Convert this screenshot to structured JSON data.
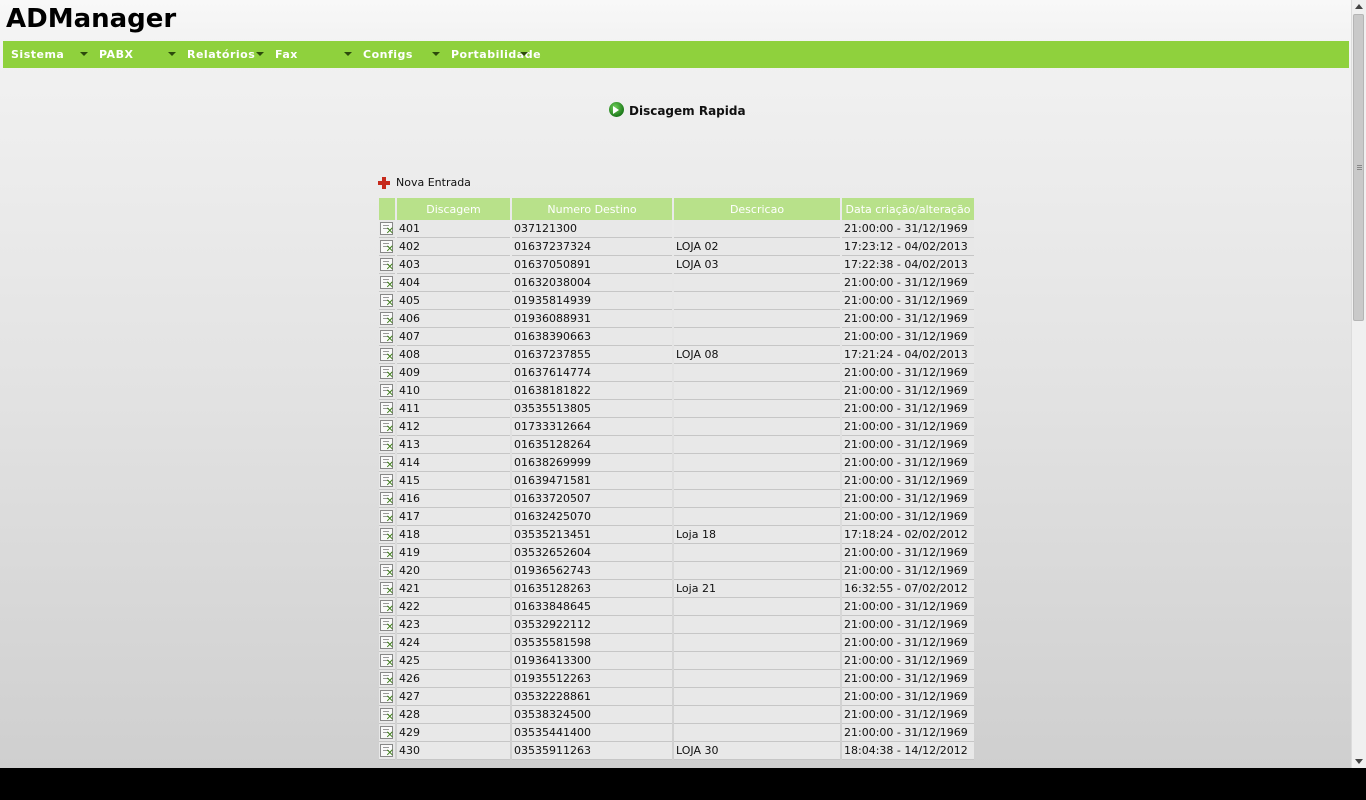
{
  "app": {
    "title": "ADManager"
  },
  "menu": [
    {
      "label": "Sistema"
    },
    {
      "label": "PABX"
    },
    {
      "label": "Relatórios"
    },
    {
      "label": "Fax"
    },
    {
      "label": "Configs"
    },
    {
      "label": "Portabilidade"
    }
  ],
  "page": {
    "heading": "Discagem Rapida",
    "new_entry_label": "Nova Entrada"
  },
  "table": {
    "columns": [
      "Discagem",
      "Numero Destino",
      "Descricao",
      "Data criação/alteração"
    ],
    "rows": [
      [
        "401",
        "037121300",
        "",
        "21:00:00 - 31/12/1969"
      ],
      [
        "402",
        "01637237324",
        "LOJA 02",
        "17:23:12 - 04/02/2013"
      ],
      [
        "403",
        "01637050891",
        "LOJA 03",
        "17:22:38 - 04/02/2013"
      ],
      [
        "404",
        "01632038004",
        "",
        "21:00:00 - 31/12/1969"
      ],
      [
        "405",
        "01935814939",
        "",
        "21:00:00 - 31/12/1969"
      ],
      [
        "406",
        "01936088931",
        "",
        "21:00:00 - 31/12/1969"
      ],
      [
        "407",
        "01638390663",
        "",
        "21:00:00 - 31/12/1969"
      ],
      [
        "408",
        "01637237855",
        "LOJA 08",
        "17:21:24 - 04/02/2013"
      ],
      [
        "409",
        "01637614774",
        "",
        "21:00:00 - 31/12/1969"
      ],
      [
        "410",
        "01638181822",
        "",
        "21:00:00 - 31/12/1969"
      ],
      [
        "411",
        "03535513805",
        "",
        "21:00:00 - 31/12/1969"
      ],
      [
        "412",
        "01733312664",
        "",
        "21:00:00 - 31/12/1969"
      ],
      [
        "413",
        "01635128264",
        "",
        "21:00:00 - 31/12/1969"
      ],
      [
        "414",
        "01638269999",
        "",
        "21:00:00 - 31/12/1969"
      ],
      [
        "415",
        "01639471581",
        "",
        "21:00:00 - 31/12/1969"
      ],
      [
        "416",
        "01633720507",
        "",
        "21:00:00 - 31/12/1969"
      ],
      [
        "417",
        "01632425070",
        "",
        "21:00:00 - 31/12/1969"
      ],
      [
        "418",
        "03535213451",
        "Loja 18",
        "17:18:24 - 02/02/2012"
      ],
      [
        "419",
        "03532652604",
        "",
        "21:00:00 - 31/12/1969"
      ],
      [
        "420",
        "01936562743",
        "",
        "21:00:00 - 31/12/1969"
      ],
      [
        "421",
        "01635128263",
        "Loja 21",
        "16:32:55 - 07/02/2012"
      ],
      [
        "422",
        "01633848645",
        "",
        "21:00:00 - 31/12/1969"
      ],
      [
        "423",
        "03532922112",
        "",
        "21:00:00 - 31/12/1969"
      ],
      [
        "424",
        "03535581598",
        "",
        "21:00:00 - 31/12/1969"
      ],
      [
        "425",
        "01936413300",
        "",
        "21:00:00 - 31/12/1969"
      ],
      [
        "426",
        "01935512263",
        "",
        "21:00:00 - 31/12/1969"
      ],
      [
        "427",
        "03532228861",
        "",
        "21:00:00 - 31/12/1969"
      ],
      [
        "428",
        "03538324500",
        "",
        "21:00:00 - 31/12/1969"
      ],
      [
        "429",
        "03535441400",
        "",
        "21:00:00 - 31/12/1969"
      ],
      [
        "430",
        "03535911263",
        "LOJA 30",
        "18:04:38 - 14/12/2012"
      ]
    ]
  },
  "colors": {
    "menubar": "#8fd13d",
    "table_header": "#b8e18a",
    "add_icon": "#c62a1c"
  },
  "icons": {
    "heading": "go-arrow-icon",
    "new_entry": "plus-icon",
    "row_action": "edit-delete-icon"
  }
}
